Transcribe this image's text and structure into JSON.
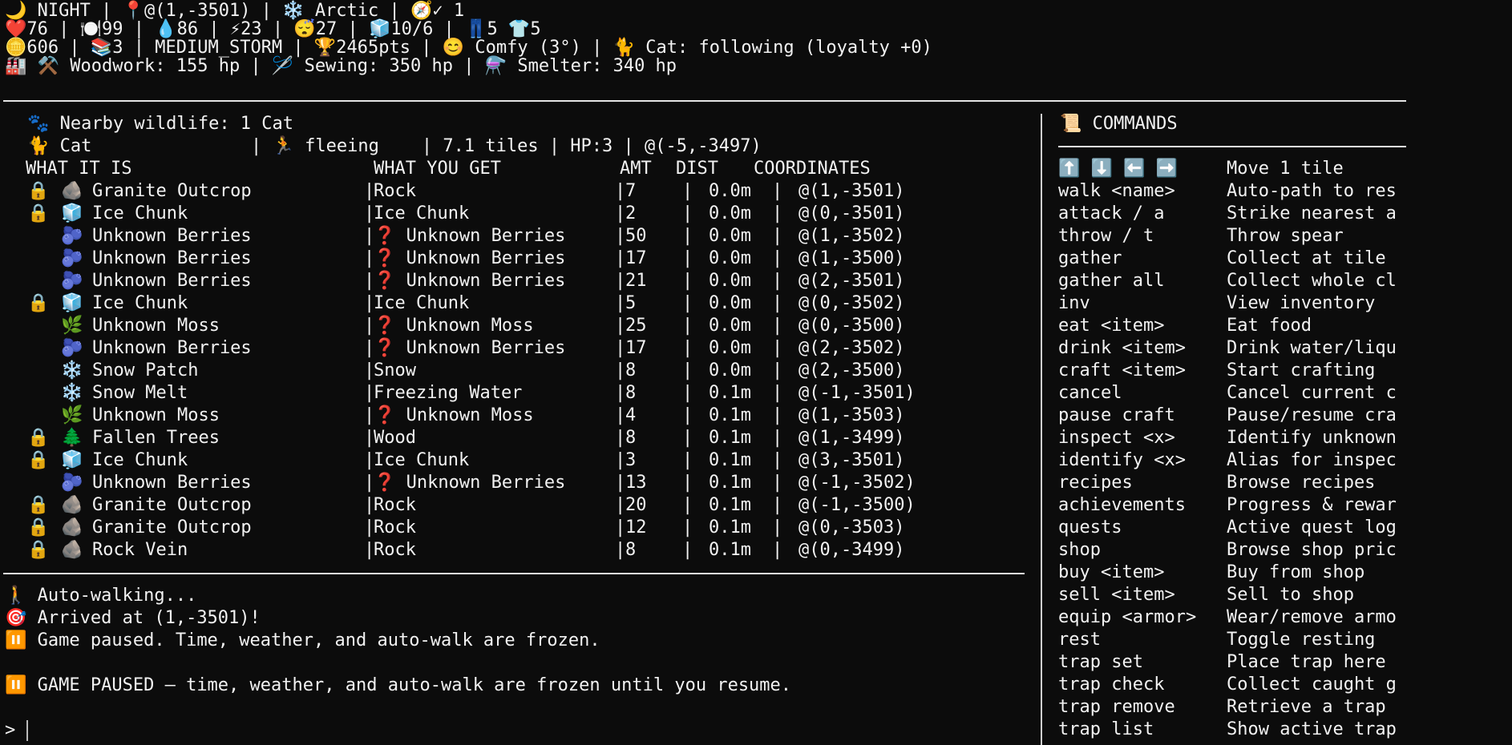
{
  "status": {
    "line1": "🌙 NIGHT | 📍@(1,-3501) | ❄️ Arctic | 🧭✓ 1",
    "line2": "❤️76 | 🍽️99 | 💧86 | ⚡23 | 😴27 | 🧊10/6 | 👖5 👕5",
    "line3": "🪙606 | 📚3 | MEDIUM_STORM | 🏆2465pts | 😊 Comfy (3°) | 🐈 Cat: following (loyalty +0)",
    "line4": "🏭 ⚒️ Woodwork: 155 hp | 🪡 Sewing: 350 hp | ⚗️ Smelter: 340 hp"
  },
  "wildlife": {
    "summary": "🐾 Nearby wildlife: 1 Cat",
    "entry": "🐈 Cat               | 🏃 fleeing    | 7.1 tiles | HP:3 | @(-5,-3497)"
  },
  "resources": {
    "headers": {
      "what": "WHAT IT IS",
      "get": "WHAT YOU GET",
      "amt": "AMT",
      "dist": "DIST",
      "coords": "COORDINATES"
    },
    "rows": [
      {
        "lock": "🔒",
        "icon": "🪨",
        "name": "Granite Outcrop",
        "get": "Rock",
        "amt": "7",
        "dist": "0.0m",
        "coords": "@(1,-3501)"
      },
      {
        "lock": "🔒",
        "icon": "🧊",
        "name": "Ice Chunk",
        "get": "Ice Chunk",
        "amt": "2",
        "dist": "0.0m",
        "coords": "@(0,-3501)"
      },
      {
        "lock": "",
        "icon": "🫐",
        "name": "Unknown Berries",
        "get": "❓ Unknown Berries",
        "amt": "50",
        "dist": "0.0m",
        "coords": "@(1,-3502)"
      },
      {
        "lock": "",
        "icon": "🫐",
        "name": "Unknown Berries",
        "get": "❓ Unknown Berries",
        "amt": "17",
        "dist": "0.0m",
        "coords": "@(1,-3500)"
      },
      {
        "lock": "",
        "icon": "🫐",
        "name": "Unknown Berries",
        "get": "❓ Unknown Berries",
        "amt": "21",
        "dist": "0.0m",
        "coords": "@(2,-3501)"
      },
      {
        "lock": "🔒",
        "icon": "🧊",
        "name": "Ice Chunk",
        "get": "Ice Chunk",
        "amt": "5",
        "dist": "0.0m",
        "coords": "@(0,-3502)"
      },
      {
        "lock": "",
        "icon": "🌿",
        "name": "Unknown Moss",
        "get": "❓ Unknown Moss",
        "amt": "25",
        "dist": "0.0m",
        "coords": "@(0,-3500)"
      },
      {
        "lock": "",
        "icon": "🫐",
        "name": "Unknown Berries",
        "get": "❓ Unknown Berries",
        "amt": "17",
        "dist": "0.0m",
        "coords": "@(2,-3502)"
      },
      {
        "lock": "",
        "icon": "❄️",
        "name": "Snow Patch",
        "get": "Snow",
        "amt": "8",
        "dist": "0.0m",
        "coords": "@(2,-3500)"
      },
      {
        "lock": "",
        "icon": "❄️",
        "name": "Snow Melt",
        "get": "Freezing Water",
        "amt": "8",
        "dist": "0.1m",
        "coords": "@(-1,-3501)"
      },
      {
        "lock": "",
        "icon": "🌿",
        "name": "Unknown Moss",
        "get": "❓ Unknown Moss",
        "amt": "4",
        "dist": "0.1m",
        "coords": "@(1,-3503)"
      },
      {
        "lock": "🔒",
        "icon": "🌲",
        "name": "Fallen Trees",
        "get": "Wood",
        "amt": "8",
        "dist": "0.1m",
        "coords": "@(1,-3499)"
      },
      {
        "lock": "🔒",
        "icon": "🧊",
        "name": "Ice Chunk",
        "get": "Ice Chunk",
        "amt": "3",
        "dist": "0.1m",
        "coords": "@(3,-3501)"
      },
      {
        "lock": "",
        "icon": "🫐",
        "name": "Unknown Berries",
        "get": "❓ Unknown Berries",
        "amt": "13",
        "dist": "0.1m",
        "coords": "@(-1,-3502)"
      },
      {
        "lock": "🔒",
        "icon": "🪨",
        "name": "Granite Outcrop",
        "get": "Rock",
        "amt": "20",
        "dist": "0.1m",
        "coords": "@(-1,-3500)"
      },
      {
        "lock": "🔒",
        "icon": "🪨",
        "name": "Granite Outcrop",
        "get": "Rock",
        "amt": "12",
        "dist": "0.1m",
        "coords": "@(0,-3503)"
      },
      {
        "lock": "🔒",
        "icon": "🪨",
        "name": "Rock Vein",
        "get": "Rock",
        "amt": "8",
        "dist": "0.1m",
        "coords": "@(0,-3499)"
      }
    ]
  },
  "log": [
    "🚶 Auto-walking...",
    "🎯 Arrived at (1,-3501)!",
    "⏸️ Game paused. Time, weather, and auto-walk are frozen.",
    "",
    "⏸️ GAME PAUSED — time, weather, and auto-walk are frozen until you resume."
  ],
  "prompt": ">",
  "commands": {
    "title": "📜 COMMANDS",
    "items": [
      {
        "cmd": "⬆️ ⬇️ ⬅️ ➡️",
        "desc": "Move 1 tile"
      },
      {
        "cmd": "walk <name>",
        "desc": "Auto-path to res"
      },
      {
        "cmd": "attack / a",
        "desc": "Strike nearest a"
      },
      {
        "cmd": "throw / t",
        "desc": "Throw spear"
      },
      {
        "cmd": "gather",
        "desc": "Collect at tile"
      },
      {
        "cmd": "gather all",
        "desc": "Collect whole cl"
      },
      {
        "cmd": "inv",
        "desc": "View inventory"
      },
      {
        "cmd": "eat <item>",
        "desc": "Eat food"
      },
      {
        "cmd": "drink <item>",
        "desc": "Drink water/liqu"
      },
      {
        "cmd": "craft <item>",
        "desc": "Start crafting"
      },
      {
        "cmd": "cancel",
        "desc": "Cancel current c"
      },
      {
        "cmd": "pause craft",
        "desc": "Pause/resume cra"
      },
      {
        "cmd": "inspect <x>",
        "desc": "Identify unknown"
      },
      {
        "cmd": "identify <x>",
        "desc": "Alias for inspec"
      },
      {
        "cmd": "recipes",
        "desc": "Browse recipes"
      },
      {
        "cmd": "achievements",
        "desc": "Progress & rewar"
      },
      {
        "cmd": "quests",
        "desc": "Active quest log"
      },
      {
        "cmd": "shop",
        "desc": "Browse shop pric"
      },
      {
        "cmd": "buy <item>",
        "desc": "Buy from shop"
      },
      {
        "cmd": "sell <item>",
        "desc": "Sell to shop"
      },
      {
        "cmd": "equip <armor>",
        "desc": "Wear/remove armo"
      },
      {
        "cmd": "rest",
        "desc": "Toggle resting"
      },
      {
        "cmd": "trap set",
        "desc": "Place trap here"
      },
      {
        "cmd": "trap check",
        "desc": "Collect caught g"
      },
      {
        "cmd": "trap remove",
        "desc": "Retrieve a trap"
      },
      {
        "cmd": "trap list",
        "desc": "Show active trap"
      }
    ]
  }
}
